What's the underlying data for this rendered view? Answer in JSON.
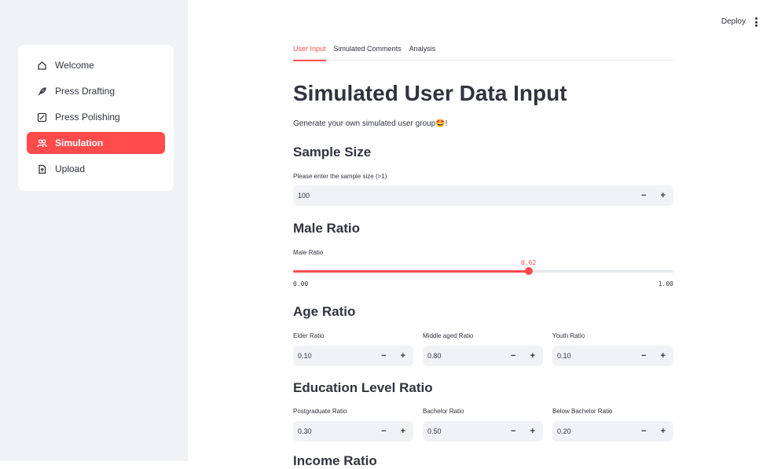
{
  "sidebar": {
    "items": [
      {
        "label": "Welcome",
        "icon": "home-icon"
      },
      {
        "label": "Press Drafting",
        "icon": "feather-icon"
      },
      {
        "label": "Press Polishing",
        "icon": "edit-box-icon"
      },
      {
        "label": "Simulation",
        "icon": "people-icon",
        "active": true
      },
      {
        "label": "Upload",
        "icon": "file-upload-icon"
      }
    ]
  },
  "topbar": {
    "deploy_label": "Deploy"
  },
  "tabs": [
    "User Input",
    "Simulated Comments",
    "Analysis"
  ],
  "page": {
    "title": "Simulated User Data Input",
    "description": "Generate your own simulated user group🤩!"
  },
  "sample_size": {
    "heading": "Sample Size",
    "label": "Please enter the sample size (>1)",
    "value": "100"
  },
  "male_ratio": {
    "heading": "Male Ratio",
    "label": "Male Ratio",
    "value": 0.62,
    "value_text": "0.62",
    "min_text": "0.00",
    "max_text": "1.00"
  },
  "age_ratio": {
    "heading": "Age Ratio",
    "fields": [
      {
        "label": "Elder Ratio",
        "value": "0.10"
      },
      {
        "label": "Middle aged Ratio",
        "value": "0.80"
      },
      {
        "label": "Youth Ratio",
        "value": "0.10"
      }
    ]
  },
  "education_ratio": {
    "heading": "Education Level Ratio",
    "fields": [
      {
        "label": "Postgraduate Ratio",
        "value": "0.30"
      },
      {
        "label": "Bachelor Ratio",
        "value": "0.50"
      },
      {
        "label": "Below Bachelor Ratio",
        "value": "0.20"
      }
    ]
  },
  "next_heading": "Income Ratio",
  "controls": {
    "minus": "−",
    "plus": "+"
  },
  "colors": {
    "accent": "#ff4b4b",
    "sidebar_bg": "#f0f2f6",
    "input_bg": "#f0f2f6",
    "text": "#31333f"
  }
}
